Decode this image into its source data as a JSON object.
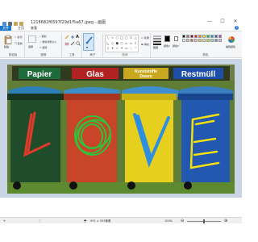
{
  "window": {
    "title": "1218682f6597f29d1f5a67.jpeg - 画图",
    "minimize": "—",
    "maximize": "☐",
    "close": "✕"
  },
  "tabs": {
    "file": "文件",
    "home": "主页",
    "view": "查看"
  },
  "ribbon": {
    "clipboard": {
      "paste": "粘贴",
      "cut": "剪切",
      "copy": "复制",
      "label": "剪贴板"
    },
    "image": {
      "select": "选择",
      "crop": "裁剪",
      "resize": "重新调整大小",
      "rotate": "旋转",
      "label": "图像"
    },
    "tools": {
      "label": "工具"
    },
    "brushes": {
      "label": "刷子"
    },
    "shapes": {
      "outline": "轮廓",
      "fill": "填充",
      "label": "形状"
    },
    "size_label": "粗细",
    "colors": {
      "color1": "颜色1",
      "color2": "颜色2",
      "edit": "编辑颜色",
      "label": "颜色",
      "color1_value": "#000000",
      "color2_value": "#ffffff"
    },
    "palette": [
      "#000000",
      "#7f7f7f",
      "#880015",
      "#ed1c24",
      "#ff7f27",
      "#fff200",
      "#22b14c",
      "#00a2e8",
      "#3f48cc",
      "#a349a4",
      "#ffffff",
      "#c3c3c3",
      "#b97a57",
      "#ffaec9",
      "#ffc90e",
      "#efe4b0",
      "#b5e61d",
      "#99d9ea",
      "#7092be",
      "#c8bfe7"
    ]
  },
  "photo": {
    "signs": [
      "Papier",
      "Glas",
      "Kunststoffe",
      "Dosen",
      "Restmüll"
    ],
    "doodle_letters": [
      "L",
      "O",
      "V",
      "E"
    ]
  },
  "status": {
    "dimensions": "991 × 553像素",
    "zoom": "100%"
  },
  "colors": {
    "accent": "#1979ca",
    "workspace": "#c9d5e5"
  }
}
